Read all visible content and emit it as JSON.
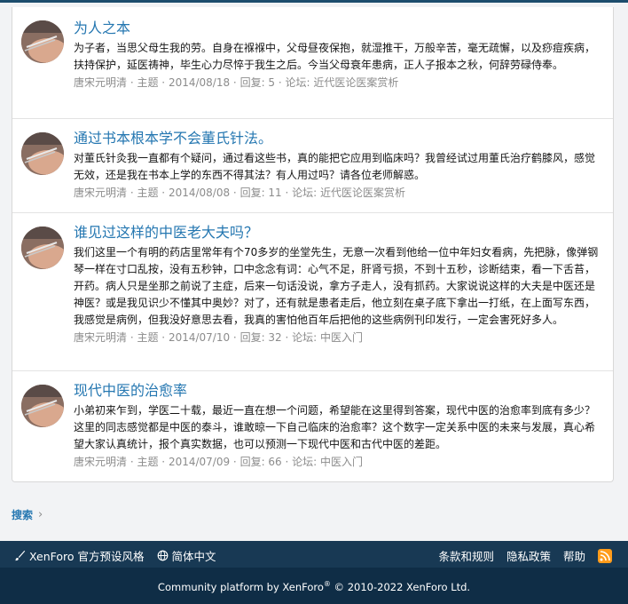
{
  "colors": {
    "link": "#2577b1",
    "meta": "#8c8c8c",
    "footer_top": "#183954",
    "footer_bottom": "#0f2d46",
    "rss": "#ff9c1b"
  },
  "results": [
    {
      "title": "为人之本",
      "snippet": "为子者，当思父母生我的劳。自身在褓褓中，父母昼夜保抱，就湿推干，万般辛苦，毫无疏懈，以及痧痘疾病，扶持保护，延医祷神，毕生心力尽悴于我生之后。今当父母衰年患病，正人子报本之秋，何辞劳碌侍奉。",
      "author": "唐宋元明清",
      "type": "主题",
      "date": "2014/08/18",
      "replies": "回复: 5",
      "forum_label": "论坛:",
      "forum": "近代医论医案赏析"
    },
    {
      "title": "通过书本根本学不会董氏针法。",
      "snippet": "对董氏针灸我一直都有个疑问，通过看这些书，真的能把它应用到临床吗？我曾经试过用董氏治疗鹤膝风，感觉无效，还是我在书本上学的东西不得其法？有人用过吗？请各位老师解惑。",
      "author": "唐宋元明清",
      "type": "主题",
      "date": "2014/08/08",
      "replies": "回复: 11",
      "forum_label": "论坛:",
      "forum": "近代医论医案赏析"
    },
    {
      "title": "谁见过这样的中医老大夫吗？",
      "snippet": "我们这里一个有明的药店里常年有个70多岁的坐堂先生，无意一次看到他给一位中年妇女看病，先把脉，像弹钢琴一样在寸口乱按，没有五秒钟，口中念念有词：心气不足，肝肾亏损，不到十五秒，诊断结束，看一下舌苔，开药。病人只是坐那之前说了主症，后来一句话没说，拿方子走人，没有抓药。大家说说这样的大夫是中医还是神医？或是我见识少不懂其中奥妙？对了，还有就是患者走后，他立刻在桌子底下拿出一打纸，在上面写东西，我感觉是病例，但我没好意思去看，我真的害怕他百年后把他的这些病例刊印发行，一定会害死好多人。",
      "author": "唐宋元明清",
      "type": "主题",
      "date": "2014/07/10",
      "replies": "回复: 32",
      "forum_label": "论坛:",
      "forum": "中医入门"
    },
    {
      "title": "现代中医的治愈率",
      "snippet": "小弟初来乍到，学医二十载，最近一直在想一个问题，希望能在这里得到答案，现代中医的治愈率到底有多少？这里的同志感觉都是中医的泰斗，谁敢晾一下自己临床的治愈率？这个数字一定关系中医的未来与发展，真心希望大家认真统计，报个真实数据，也可以预测一下现代中医和古代中医的差距。",
      "author": "唐宋元明清",
      "type": "主题",
      "date": "2014/07/09",
      "replies": "回复: 66",
      "forum_label": "论坛:",
      "forum": "中医入门"
    }
  ],
  "breadcrumb": {
    "label": "搜索",
    "chevron_icon": "chevron-right-icon"
  },
  "footer": {
    "style_label": "XenForo 官方预设风格",
    "language_label": "简体中文",
    "terms_label": "条款和规则",
    "privacy_label": "隐私政策",
    "help_label": "帮助",
    "rss_icon": "rss-icon",
    "copyright_prefix": "Community platform by XenForo",
    "copyright_reg": "®",
    "copyright_suffix": " © 2010-2022 XenForo Ltd."
  }
}
